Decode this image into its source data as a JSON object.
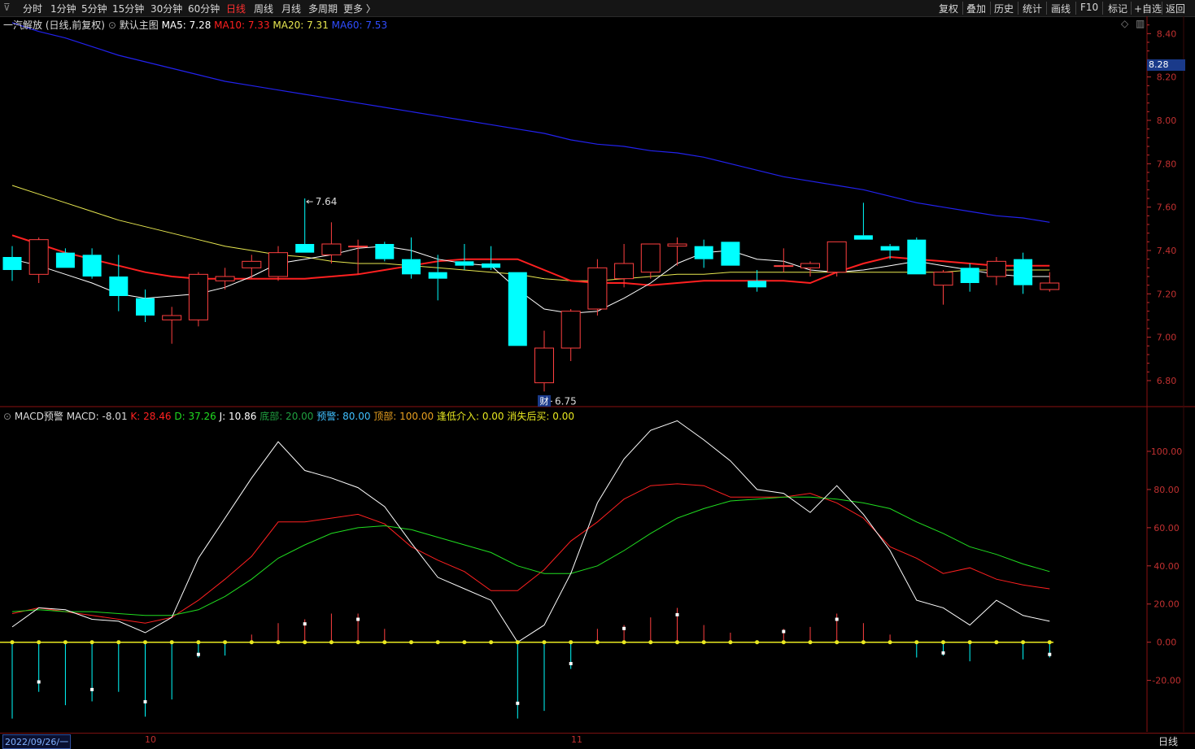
{
  "toolbar": {
    "left_items": [
      "分时",
      "1分钟",
      "5分钟",
      "15分钟",
      "30分钟",
      "60分钟",
      "日线",
      "周线",
      "月线",
      "多周期",
      "更多 〉"
    ],
    "active_item": "日线",
    "right_items": [
      "复权",
      "叠加",
      "历史",
      "统计",
      "画线",
      "F10",
      "标记",
      "+自选",
      "返回"
    ]
  },
  "main_legend": {
    "title": "一汽解放 (日线,前复权)",
    "indicator": "默认主图",
    "ma5": "MA5: 7.28",
    "ma10": "MA10: 7.33",
    "ma20": "MA20: 7.31",
    "ma60": "MA60: 7.53"
  },
  "sub_legend": {
    "indicator": "MACD预警",
    "macd": "MACD: -8.01",
    "k": "K: 28.46",
    "d": "D: 37.26",
    "j": "J: 10.86",
    "bottom": "底部: 20.00",
    "warn": "预警: 80.00",
    "top": "顶部: 100.00",
    "low_entry": "逢低介入: 0.00",
    "buy_after": "消失后买: 0.00"
  },
  "annotations": {
    "high_label": "7.64",
    "low_label": "6.75",
    "fin_marker": "财",
    "current_price": "8.28"
  },
  "x_axis": {
    "start_date": "2022/09/26/一",
    "month_ticks": [
      "10",
      "11"
    ],
    "period_label": "日线"
  },
  "colors": {
    "up": "#ff4040",
    "down": "#00ffff",
    "ma5": "#ffffff",
    "ma10": "#ff2020",
    "ma20": "#e8e850",
    "ma60": "#2222ee",
    "k": "#ff2020",
    "d": "#20dd20",
    "j": "#ffffff",
    "zero_line": "#e8e820",
    "axis": "#c03030"
  },
  "chart_data": [
    {
      "type": "candlestick",
      "title": "一汽解放 (日线,前复权)",
      "y_ticks": [
        6.8,
        7.0,
        7.2,
        7.4,
        7.6,
        7.8,
        8.0,
        8.2,
        8.4
      ],
      "ylim": [
        6.68,
        8.48
      ],
      "candles": [
        {
          "o": 7.37,
          "h": 7.42,
          "l": 7.26,
          "c": 7.31
        },
        {
          "o": 7.29,
          "h": 7.46,
          "l": 7.25,
          "c": 7.45
        },
        {
          "o": 7.39,
          "h": 7.41,
          "l": 7.32,
          "c": 7.32
        },
        {
          "o": 7.38,
          "h": 7.41,
          "l": 7.27,
          "c": 7.28
        },
        {
          "o": 7.28,
          "h": 7.38,
          "l": 7.12,
          "c": 7.19
        },
        {
          "o": 7.18,
          "h": 7.22,
          "l": 7.07,
          "c": 7.1
        },
        {
          "o": 7.08,
          "h": 7.14,
          "l": 6.97,
          "c": 7.1
        },
        {
          "o": 7.08,
          "h": 7.3,
          "l": 7.05,
          "c": 7.29
        },
        {
          "o": 7.26,
          "h": 7.32,
          "l": 7.22,
          "c": 7.28
        },
        {
          "o": 7.32,
          "h": 7.38,
          "l": 7.27,
          "c": 7.35
        },
        {
          "o": 7.28,
          "h": 7.42,
          "l": 7.26,
          "c": 7.39
        },
        {
          "o": 7.43,
          "h": 7.64,
          "l": 7.39,
          "c": 7.39
        },
        {
          "o": 7.38,
          "h": 7.53,
          "l": 7.34,
          "c": 7.43
        },
        {
          "o": 7.42,
          "h": 7.45,
          "l": 7.29,
          "c": 7.42
        },
        {
          "o": 7.43,
          "h": 7.44,
          "l": 7.35,
          "c": 7.36
        },
        {
          "o": 7.36,
          "h": 7.46,
          "l": 7.27,
          "c": 7.29
        },
        {
          "o": 7.3,
          "h": 7.38,
          "l": 7.17,
          "c": 7.27
        },
        {
          "o": 7.35,
          "h": 7.43,
          "l": 7.31,
          "c": 7.33
        },
        {
          "o": 7.34,
          "h": 7.42,
          "l": 7.31,
          "c": 7.32
        },
        {
          "o": 7.3,
          "h": 7.3,
          "l": 6.96,
          "c": 6.96
        },
        {
          "o": 6.79,
          "h": 7.03,
          "l": 6.75,
          "c": 6.95
        },
        {
          "o": 6.95,
          "h": 7.13,
          "l": 6.89,
          "c": 7.12
        },
        {
          "o": 7.13,
          "h": 7.36,
          "l": 7.1,
          "c": 7.32
        },
        {
          "o": 7.27,
          "h": 7.43,
          "l": 7.23,
          "c": 7.34
        },
        {
          "o": 7.3,
          "h": 7.43,
          "l": 7.27,
          "c": 7.43
        },
        {
          "o": 7.42,
          "h": 7.46,
          "l": 7.33,
          "c": 7.43
        },
        {
          "o": 7.42,
          "h": 7.45,
          "l": 7.32,
          "c": 7.36
        },
        {
          "o": 7.44,
          "h": 7.44,
          "l": 7.33,
          "c": 7.33
        },
        {
          "o": 7.26,
          "h": 7.31,
          "l": 7.21,
          "c": 7.23
        },
        {
          "o": 7.33,
          "h": 7.41,
          "l": 7.3,
          "c": 7.33
        },
        {
          "o": 7.32,
          "h": 7.35,
          "l": 7.28,
          "c": 7.34
        },
        {
          "o": 7.3,
          "h": 7.44,
          "l": 7.28,
          "c": 7.44
        },
        {
          "o": 7.47,
          "h": 7.62,
          "l": 7.45,
          "c": 7.45
        },
        {
          "o": 7.42,
          "h": 7.43,
          "l": 7.36,
          "c": 7.4
        },
        {
          "o": 7.45,
          "h": 7.46,
          "l": 7.29,
          "c": 7.29
        },
        {
          "o": 7.24,
          "h": 7.31,
          "l": 7.15,
          "c": 7.3
        },
        {
          "o": 7.32,
          "h": 7.34,
          "l": 7.21,
          "c": 7.25
        },
        {
          "o": 7.28,
          "h": 7.37,
          "l": 7.24,
          "c": 7.35
        },
        {
          "o": 7.36,
          "h": 7.39,
          "l": 7.2,
          "c": 7.24
        },
        {
          "o": 7.22,
          "h": 7.3,
          "l": 7.21,
          "c": 7.25
        }
      ],
      "ma5": [
        7.36,
        7.33,
        7.29,
        7.25,
        7.2,
        7.18,
        7.19,
        7.2,
        7.23,
        7.28,
        7.34,
        7.36,
        7.38,
        7.41,
        7.42,
        7.4,
        7.36,
        7.34,
        7.33,
        7.22,
        7.13,
        7.11,
        7.12,
        7.18,
        7.25,
        7.34,
        7.39,
        7.4,
        7.36,
        7.35,
        7.31,
        7.3,
        7.31,
        7.33,
        7.35,
        7.33,
        7.31,
        7.29,
        7.28,
        7.28
      ],
      "ma10": [
        7.47,
        7.43,
        7.39,
        7.36,
        7.33,
        7.3,
        7.28,
        7.27,
        7.27,
        7.27,
        7.27,
        7.27,
        7.28,
        7.29,
        7.31,
        7.33,
        7.35,
        7.36,
        7.36,
        7.36,
        7.31,
        7.26,
        7.25,
        7.25,
        7.24,
        7.25,
        7.26,
        7.26,
        7.26,
        7.26,
        7.25,
        7.3,
        7.34,
        7.37,
        7.36,
        7.35,
        7.34,
        7.33,
        7.33,
        7.33
      ],
      "ma20": [
        7.7,
        7.66,
        7.62,
        7.58,
        7.54,
        7.51,
        7.48,
        7.45,
        7.42,
        7.4,
        7.38,
        7.37,
        7.35,
        7.34,
        7.34,
        7.33,
        7.32,
        7.31,
        7.3,
        7.29,
        7.27,
        7.26,
        7.26,
        7.27,
        7.28,
        7.29,
        7.29,
        7.3,
        7.3,
        7.3,
        7.3,
        7.3,
        7.3,
        7.3,
        7.3,
        7.3,
        7.31,
        7.31,
        7.31,
        7.31
      ],
      "ma60": [
        8.45,
        8.41,
        8.38,
        8.34,
        8.3,
        8.27,
        8.24,
        8.21,
        8.18,
        8.16,
        8.14,
        8.12,
        8.1,
        8.08,
        8.06,
        8.04,
        8.02,
        8.0,
        7.98,
        7.96,
        7.94,
        7.91,
        7.89,
        7.88,
        7.86,
        7.85,
        7.83,
        7.8,
        7.77,
        7.74,
        7.72,
        7.7,
        7.68,
        7.65,
        7.62,
        7.6,
        7.58,
        7.56,
        7.55,
        7.53
      ]
    },
    {
      "type": "line",
      "title": "MACD预警",
      "y_ticks": [
        -20,
        0,
        20,
        40,
        60,
        80,
        100
      ],
      "ylim": [
        -47,
        123
      ],
      "series": [
        {
          "name": "K",
          "values": [
            15,
            18,
            16,
            14,
            12,
            10,
            13,
            22,
            33,
            45,
            63,
            63,
            65,
            67,
            62,
            50,
            43,
            37,
            27,
            27,
            38,
            53,
            63,
            75,
            82,
            83,
            82,
            76,
            76,
            76,
            78,
            73,
            65,
            50,
            44,
            36,
            39,
            33,
            30,
            28
          ]
        },
        {
          "name": "D",
          "values": [
            16,
            17,
            16,
            16,
            15,
            14,
            14,
            17,
            24,
            33,
            44,
            51,
            57,
            60,
            61,
            59,
            55,
            51,
            47,
            40,
            36,
            36,
            40,
            48,
            57,
            65,
            70,
            74,
            75,
            76,
            76,
            75,
            73,
            70,
            63,
            57,
            50,
            46,
            41,
            37
          ]
        },
        {
          "name": "J",
          "values": [
            8,
            18,
            17,
            12,
            11,
            5,
            13,
            44,
            65,
            86,
            105,
            90,
            86,
            81,
            71,
            52,
            34,
            28,
            22,
            0,
            9,
            36,
            73,
            96,
            111,
            116,
            106,
            95,
            80,
            78,
            68,
            82,
            67,
            48,
            22,
            18,
            9,
            22,
            14,
            11
          ]
        }
      ],
      "macd_bars": [
        -40,
        -26,
        -33,
        -31,
        -26,
        -39,
        -30,
        -8,
        -7,
        4,
        10,
        12,
        15,
        15,
        7,
        0,
        0,
        0,
        0,
        -40,
        -36,
        -14,
        7,
        9,
        13,
        18,
        9,
        5,
        0,
        7,
        8,
        15,
        10,
        4,
        -8,
        -7,
        -10,
        0,
        -9,
        -8
      ]
    }
  ]
}
